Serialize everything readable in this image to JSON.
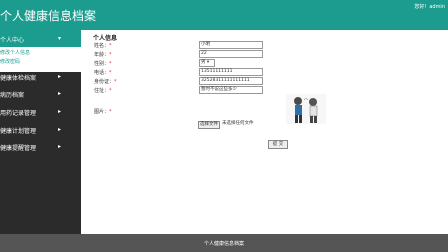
{
  "header": {
    "title": "个人健康信息档案",
    "user": "您好！admin"
  },
  "sidebar": {
    "items": [
      {
        "label": "个人中心",
        "arrow": "▾"
      },
      {
        "label": "健康体检档案",
        "arrow": "▸"
      },
      {
        "label": "病历档案",
        "arrow": "▸"
      },
      {
        "label": "用药记录管理",
        "arrow": "▸"
      },
      {
        "label": "健康计划管理",
        "arrow": "▸"
      },
      {
        "label": "健康提醒管理",
        "arrow": "▸"
      }
    ],
    "subitems": [
      {
        "label": "修改个人信息"
      },
      {
        "label": "修改密码"
      }
    ]
  },
  "form": {
    "section_title": "个人信息",
    "name_label": "姓名：",
    "name_value": "小明",
    "age_label": "年龄：",
    "age_value": "22",
    "gender_label": "性别：",
    "gender_value": "男 ▾",
    "phone_label": "电话：",
    "phone_value": "13511111111",
    "idcard_label": "身份证：",
    "idcard_value": "32528311111111111",
    "address_label": "住址：",
    "address_value": "暂时不说这些多少",
    "photo_label": "图片：",
    "required_mark": "*",
    "file_button": "选择文件",
    "file_status": "未选择任何文件",
    "submit_label": "提 交"
  },
  "footer": {
    "text": "个人健康信息档案"
  }
}
